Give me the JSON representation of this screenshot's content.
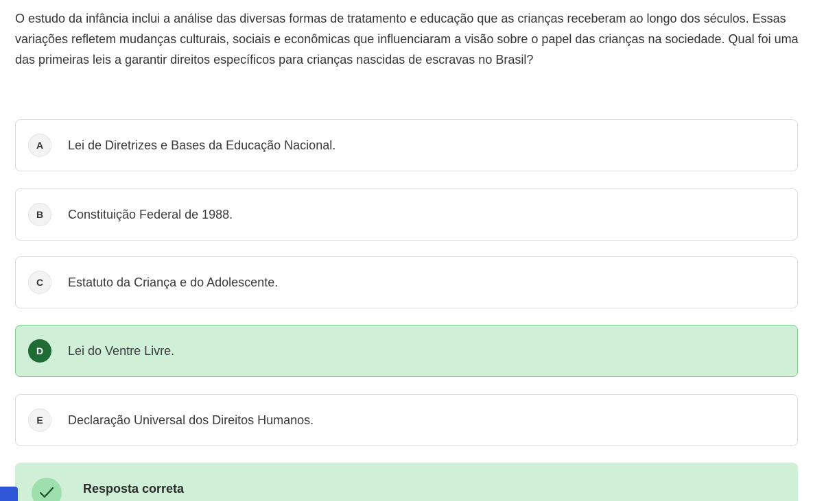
{
  "question": {
    "text": "O estudo da infância inclui a análise das diversas formas de tratamento e educação que as crianças receberam ao longo dos séculos. Essas variações refletem mudanças culturais, sociais e econômicas que influenciaram a visão sobre o papel das crianças na sociedade. Qual foi uma das primeiras leis a garantir direitos específicos para crianças nascidas de escravas no Brasil?"
  },
  "options": [
    {
      "letter": "A",
      "text": "Lei de Diretrizes e Bases da Educação Nacional.",
      "selected": false
    },
    {
      "letter": "B",
      "text": "Constituição Federal de 1988.",
      "selected": false
    },
    {
      "letter": "C",
      "text": "Estatuto da Criança e do Adolescente.",
      "selected": false
    },
    {
      "letter": "D",
      "text": "Lei do Ventre Livre.",
      "selected": true
    },
    {
      "letter": "E",
      "text": "Declaração Universal dos Direitos Humanos.",
      "selected": false
    }
  ],
  "feedback": {
    "title": "Resposta correta",
    "icon": "check-icon"
  },
  "colors": {
    "selected_bg": "#cfefd6",
    "selected_border": "#7fcf92",
    "selected_letter_bg": "#1e6b34",
    "side_tab": "#2f56d6"
  }
}
